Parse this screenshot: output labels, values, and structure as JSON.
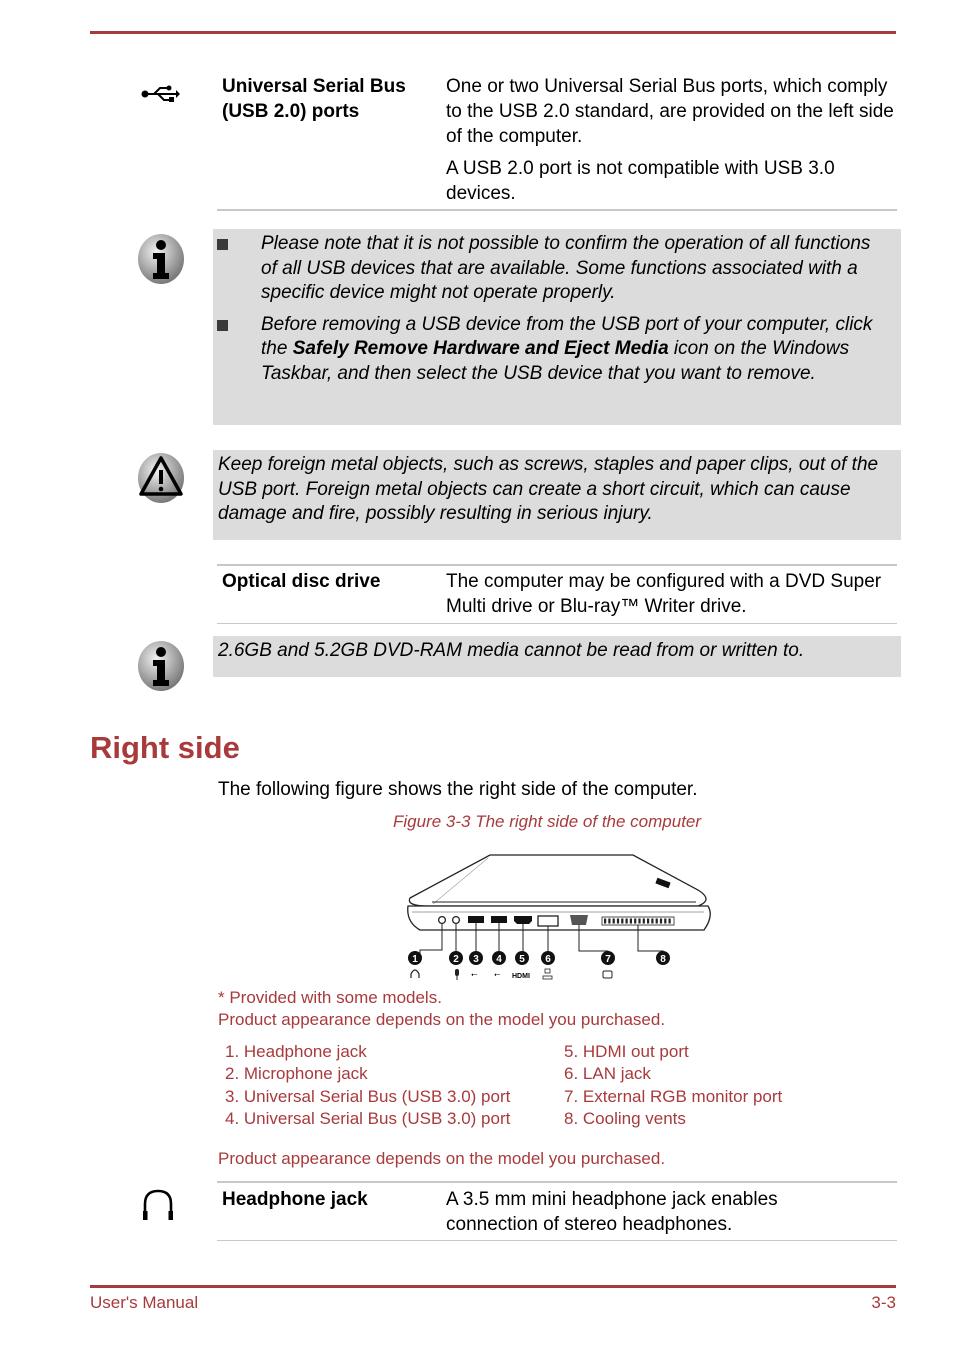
{
  "usb_entry": {
    "icon": "usb-icon",
    "term": [
      "Universal Serial Bus",
      "(USB 2.0) ports"
    ],
    "description": [
      "One or two Universal Serial Bus ports, which comply to the USB 2.0 standard, are provided on the left side of the computer.",
      "A USB 2.0 port is not compatible with USB 3.0 devices."
    ]
  },
  "usb_note": {
    "icon": "info-icon",
    "bullets": [
      {
        "before": "Please note that it is not possible to confirm the operation of all functions of all USB devices that are available. Some functions associated with a specific device might not operate properly.",
        "bold": "",
        "after": ""
      },
      {
        "before": "Before removing a USB device from the USB port of your computer, click the ",
        "bold": "Safely Remove Hardware and Eject Media",
        "after": " icon on the Windows Taskbar, and then select the USB device that you want to remove."
      }
    ]
  },
  "usb_warning": {
    "icon": "warning-icon",
    "text": "Keep foreign metal objects, such as screws, staples and paper clips, out of the USB port. Foreign metal objects can create a short circuit, which can cause damage and fire, possibly resulting in serious injury."
  },
  "optical_entry": {
    "term": "Optical disc drive",
    "description": "The computer may be configured with a DVD Super Multi drive or Blu-ray™ Writer drive."
  },
  "optical_note": {
    "icon": "info-icon",
    "text": "2.6GB and 5.2GB DVD-RAM media cannot be read from or written to."
  },
  "section": {
    "heading": "Right side",
    "intro": "The following figure shows the right side of the computer.",
    "figure_caption": "Figure 3-3 The right side of the computer",
    "figure_callouts": [
      "1",
      "2",
      "3",
      "4",
      "5",
      "6",
      "7",
      "8"
    ],
    "figure_port_symbols": [
      "headphone",
      "microphone",
      "usb",
      "usb",
      "HDMI",
      "lan",
      "monitor"
    ],
    "footnote_1": "* Provided with some models.",
    "footnote_2": "Product appearance depends on the model you purchased.",
    "legend_left": [
      "1. Headphone jack",
      "2. Microphone jack",
      "3. Universal Serial Bus (USB 3.0) port",
      "4. Universal Serial Bus (USB 3.0) port"
    ],
    "legend_right": [
      "5. HDMI out port",
      "6. LAN jack",
      "7. External RGB monitor port",
      "8. Cooling vents"
    ],
    "footnote_3": "Product appearance depends on the model you purchased."
  },
  "headphone_entry": {
    "icon": "headphone-icon",
    "term": "Headphone jack",
    "description": "A 3.5 mm mini headphone jack enables connection of stereo headphones."
  },
  "footer": {
    "left": "User's Manual",
    "right": "3-3"
  }
}
